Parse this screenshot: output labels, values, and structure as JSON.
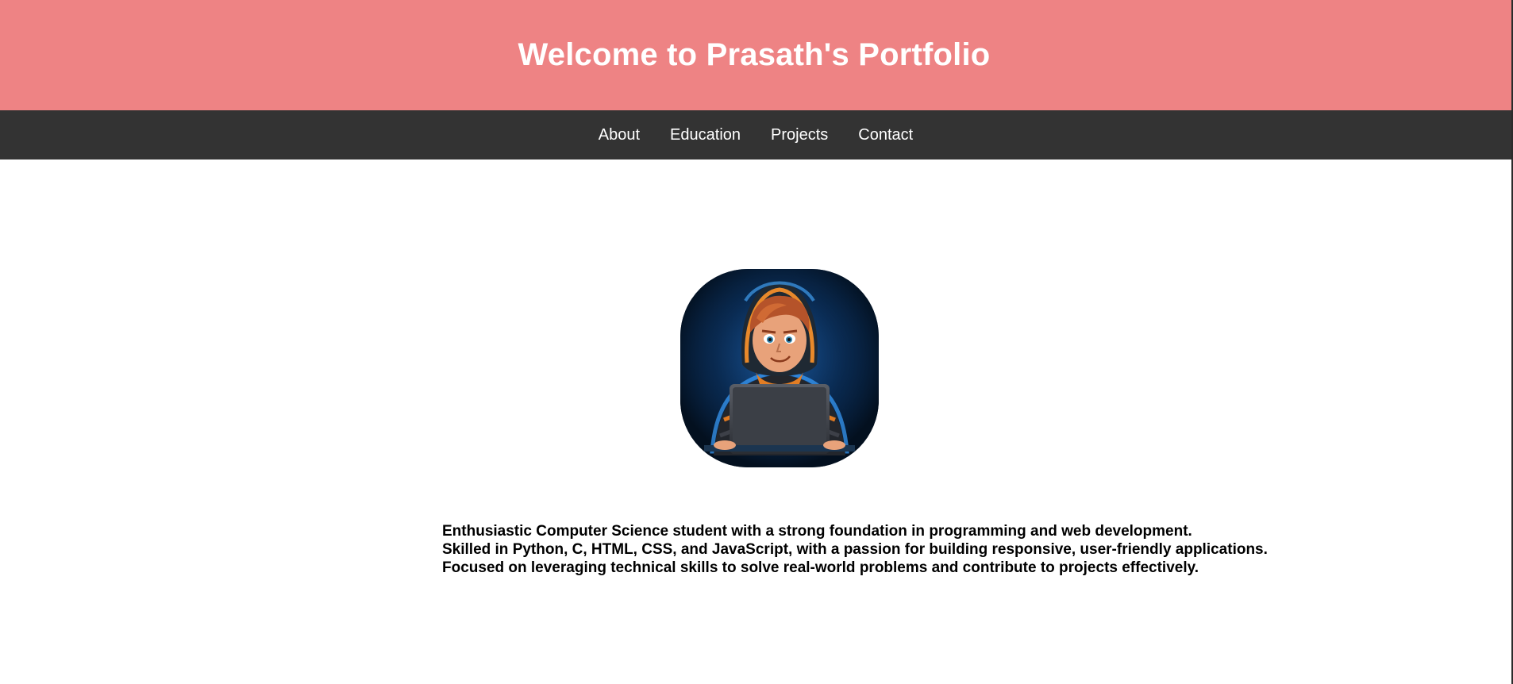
{
  "header": {
    "title": "Welcome to Prasath's Portfolio"
  },
  "nav": {
    "items": [
      {
        "label": "About"
      },
      {
        "label": "Education"
      },
      {
        "label": "Projects"
      },
      {
        "label": "Contact"
      }
    ]
  },
  "profile": {
    "avatar_icon": "hooded-coder-with-laptop-illustration"
  },
  "about": {
    "lines": [
      "Enthusiastic Computer Science student with a strong foundation in programming and web development.",
      "Skilled in Python, C, HTML, CSS, and JavaScript, with a passion for building responsive, user-friendly applications.",
      "Focused on leveraging technical skills to solve real-world problems and contribute to projects effectively."
    ]
  },
  "colors": {
    "header_bg": "#ee8384",
    "nav_bg": "#333333",
    "text": "#000000",
    "header_text": "#ffffff"
  }
}
